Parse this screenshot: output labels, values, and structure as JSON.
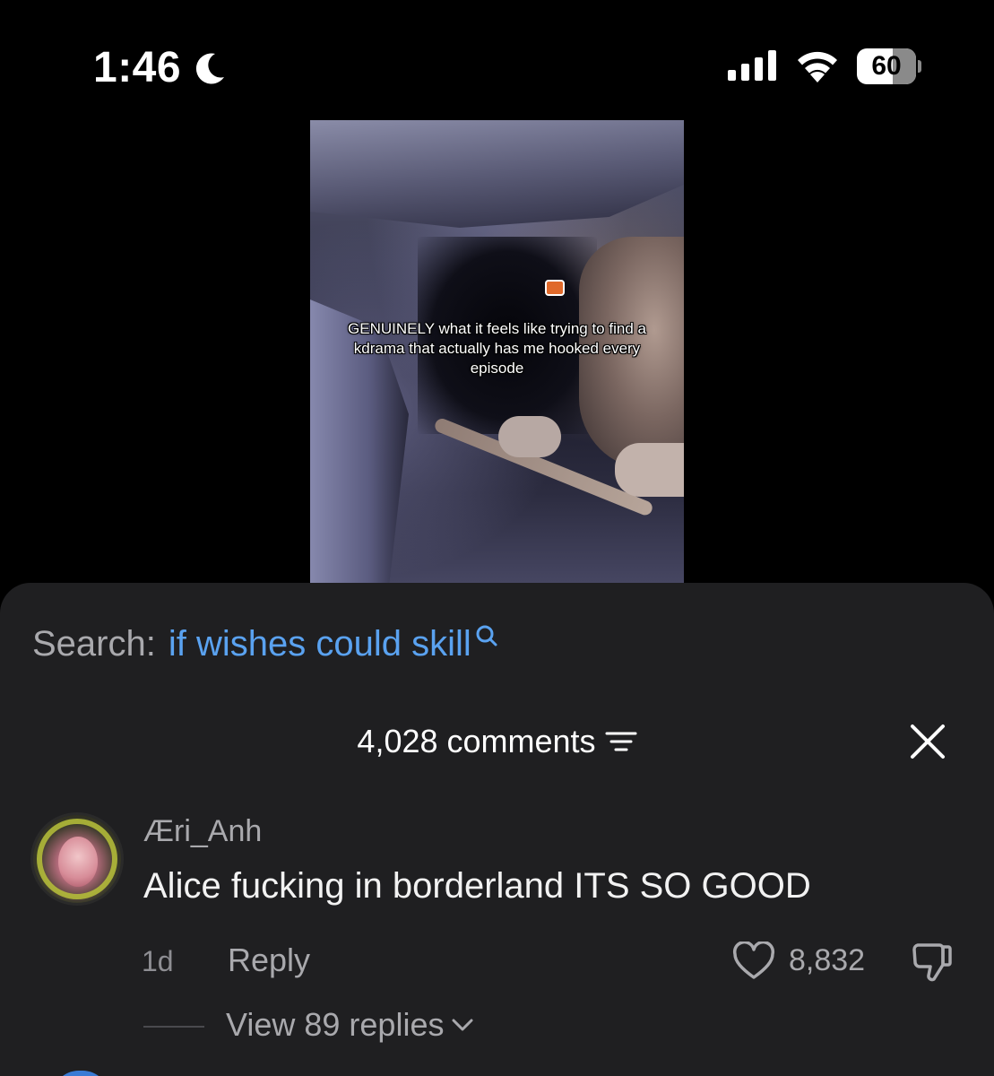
{
  "status_bar": {
    "time": "1:46",
    "battery": "60",
    "battery_level_percent": 60
  },
  "video": {
    "caption": "GENUINELY what it feels like trying to find a kdrama that actually has me hooked every episode"
  },
  "search": {
    "label": "Search:",
    "term": "if wishes could skill"
  },
  "comments": {
    "count_label": "4,028 comments"
  },
  "comment": {
    "username": "Æri_Anh",
    "text": "Alice fucking in borderland ITS SO GOOD",
    "age": "1d",
    "reply_label": "Reply",
    "likes": "8,832",
    "view_replies": "View 89 replies"
  },
  "colors": {
    "link_blue": "#5aa2f0",
    "sheet_bg": "#1f1f21",
    "muted_text": "#a9a9ad"
  }
}
